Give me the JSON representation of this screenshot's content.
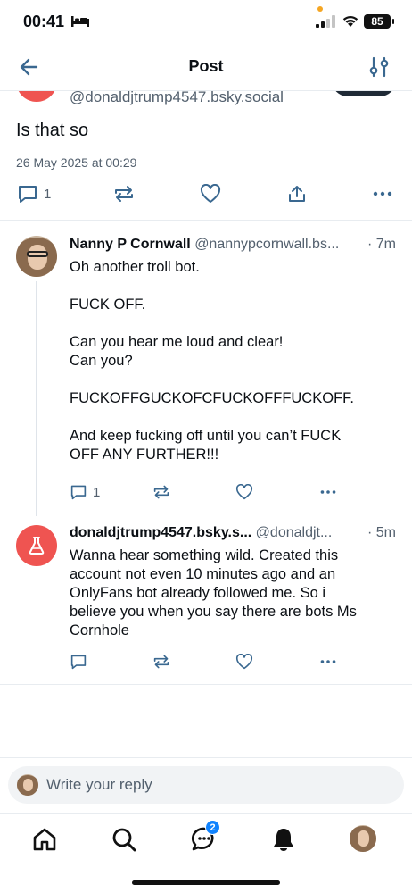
{
  "status_bar": {
    "time": "00:41",
    "battery": "85"
  },
  "header": {
    "title": "Post"
  },
  "main_post": {
    "handle": "@donaldjtrump4547.bsky.social",
    "text": "Is that so",
    "date": "26 May 2025 at 00:29",
    "reply_count": "1"
  },
  "replies": [
    {
      "name": "Nanny P Cornwall",
      "handle": "@nannypcornwall.bs...",
      "time": "· 7m",
      "paragraphs": [
        "Oh another troll bot.",
        "FUCK OFF.",
        "Can you hear me loud and clear!\nCan you?",
        "FUCKOFFGUCKOFCFUCKOFFFUCKOFF.",
        "And keep fucking off until you can’t FUCK OFF ANY FURTHER!!!"
      ],
      "reply_count": "1"
    },
    {
      "name": "donaldjtrump4547.bsky.s...",
      "handle": "@donaldjt...",
      "time": "· 5m",
      "paragraphs": [
        "Wanna hear something wild. Created this account not even 10 minutes ago and an OnlyFans bot already followed me. So i believe you when you say there are bots Ms Cornhole"
      ],
      "reply_count": ""
    }
  ],
  "composer": {
    "placeholder": "Write your reply"
  },
  "tabbar": {
    "chat_badge": "2"
  },
  "icons": {
    "back": "arrow-left-icon",
    "filter": "sliders-icon",
    "reply": "speech-bubble-icon",
    "repost": "repost-arrows-icon",
    "like": "heart-icon",
    "share": "share-icon",
    "more": "ellipsis-icon",
    "home": "home-icon",
    "search": "search-icon",
    "chat": "chat-icon",
    "notifications": "bell-icon"
  },
  "colors": {
    "accent": "#1083fe",
    "muted": "#53606e",
    "avatar_red": "#ef5451"
  }
}
